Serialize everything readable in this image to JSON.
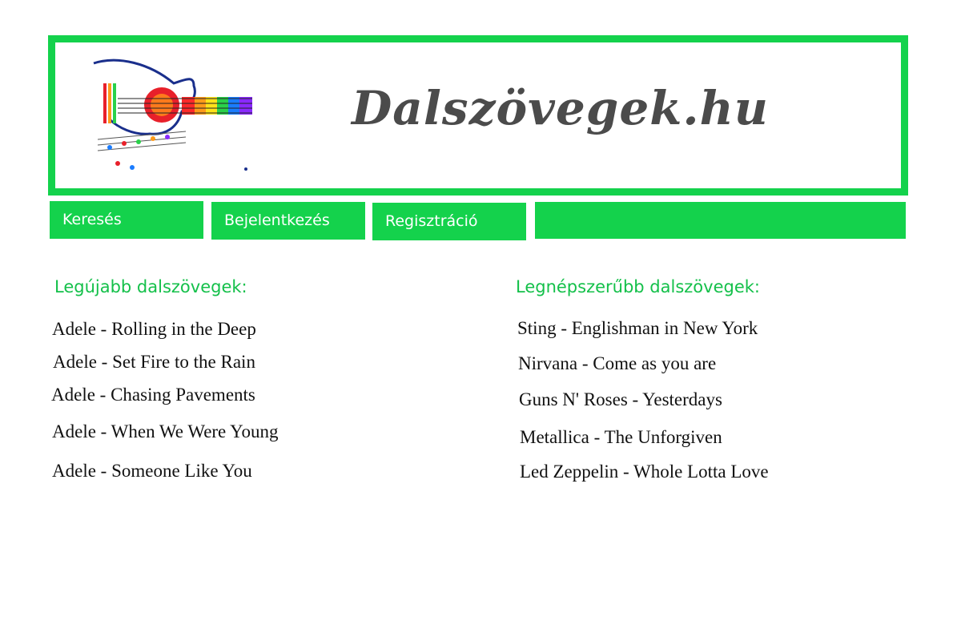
{
  "header": {
    "site_title": "Dalszövegek.hu",
    "logo_icon": "guitar-music-notes-logo",
    "brand_color": "#14d24c"
  },
  "nav": {
    "items": [
      {
        "label": "Keresés"
      },
      {
        "label": "Bejelentkezés"
      },
      {
        "label": "Regisztráció"
      }
    ]
  },
  "latest": {
    "title": "Legújabb dalszövegek:",
    "songs": [
      "Adele - Rolling in the Deep",
      "Adele - Set Fire to the Rain",
      "Adele - Chasing Pavements",
      "Adele - When We Were Young",
      "Adele - Someone Like You"
    ]
  },
  "popular": {
    "title": "Legnépszerűbb dalszövegek:",
    "songs": [
      "Sting - Englishman in New York",
      "Nirvana - Come as you are",
      "Guns N' Roses - Yesterdays",
      "Metallica - The Unforgiven",
      "Led Zeppelin - Whole Lotta Love"
    ]
  }
}
